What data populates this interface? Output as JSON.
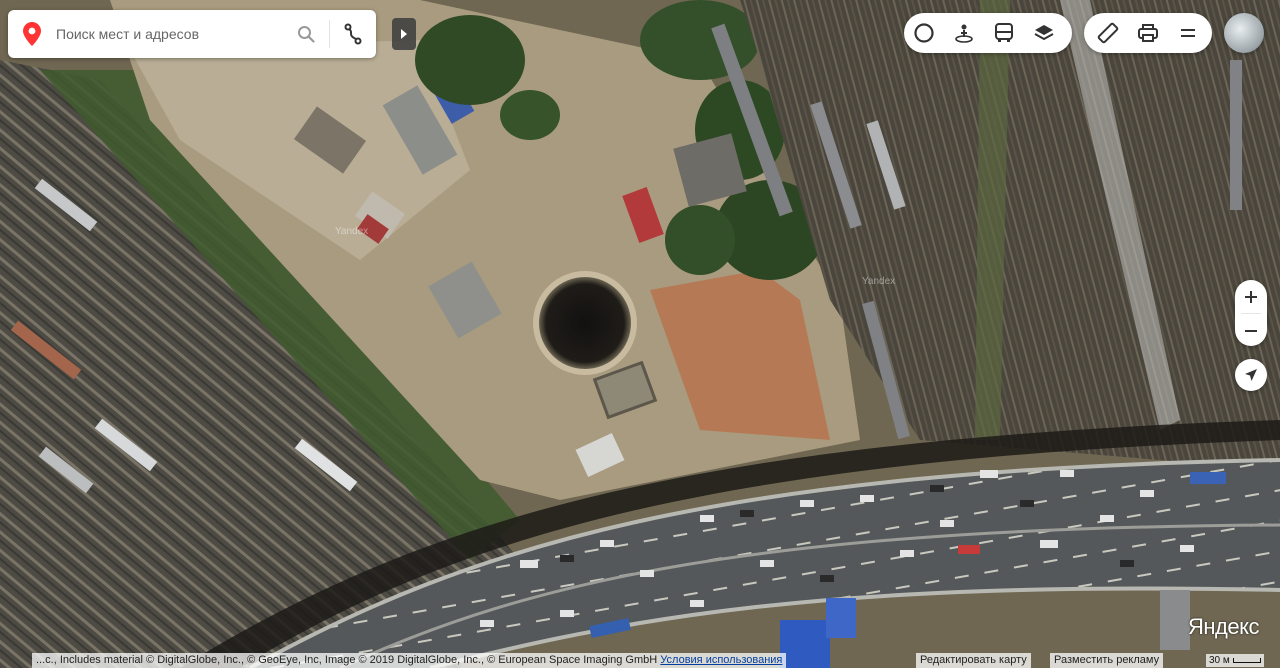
{
  "search": {
    "placeholder": "Поиск мест и адресов"
  },
  "icons": {
    "pin": "map-pin-icon",
    "search": "search-icon",
    "routes": "route-icon",
    "collapse": "chevron-right-icon",
    "traffic": "traffic-icon",
    "panorama": "panorama-icon",
    "transit": "bus-icon",
    "layers": "layers-icon",
    "ruler": "ruler-icon",
    "print": "print-icon",
    "menu": "menu-icon",
    "zoom_in": "plus-icon",
    "zoom_out": "minus-icon",
    "geolocation": "geolocation-icon"
  },
  "colors": {
    "pin": "#ff3333",
    "ui_bg": "#ffffff",
    "icon": "#333333",
    "link": "#0440a0"
  },
  "map": {
    "watermark": "Yandex",
    "logo": "Яндекс",
    "scale_label": "30 м"
  },
  "footer": {
    "copyright": "...c., Includes material © DigitalGlobe, Inc., © GeoEye, Inc, Image © 2019 DigitalGlobe, Inc., © European Space Imaging GmbH",
    "terms": "Условия использования",
    "edit_map": "Редактировать карту",
    "advertise": "Разместить рекламу"
  }
}
